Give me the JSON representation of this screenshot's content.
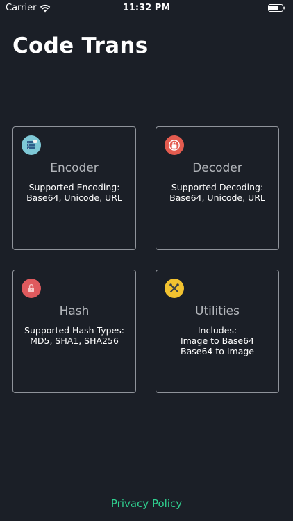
{
  "status_bar": {
    "carrier": "Carrier",
    "time": "11:32 PM"
  },
  "app": {
    "title": "Code Trans"
  },
  "cards": [
    {
      "id": "encoder",
      "title": "Encoder",
      "lines": [
        "Supported Encoding:",
        "Base64, Unicode, URL"
      ],
      "icon": "encoder-icon",
      "icon_color": "#7ec8d6"
    },
    {
      "id": "decoder",
      "title": "Decoder",
      "lines": [
        "Supported Decoding:",
        "Base64, Unicode, URL"
      ],
      "icon": "unlock-icon",
      "icon_color": "#e35b4f"
    },
    {
      "id": "hash",
      "title": "Hash",
      "lines": [
        "Supported Hash Types:",
        "MD5, SHA1, SHA256"
      ],
      "icon": "lock-icon",
      "icon_color": "#df5a5e"
    },
    {
      "id": "utilities",
      "title": "Utilities",
      "lines": [
        "Includes:",
        "Image to Base64",
        "Base64 to Image"
      ],
      "icon": "tools-icon",
      "icon_color": "#f2c230"
    }
  ],
  "footer": {
    "privacy_label": "Privacy Policy"
  },
  "colors": {
    "background": "#1b1f27",
    "card_border": "#8f939a",
    "link": "#2fcf8f"
  }
}
